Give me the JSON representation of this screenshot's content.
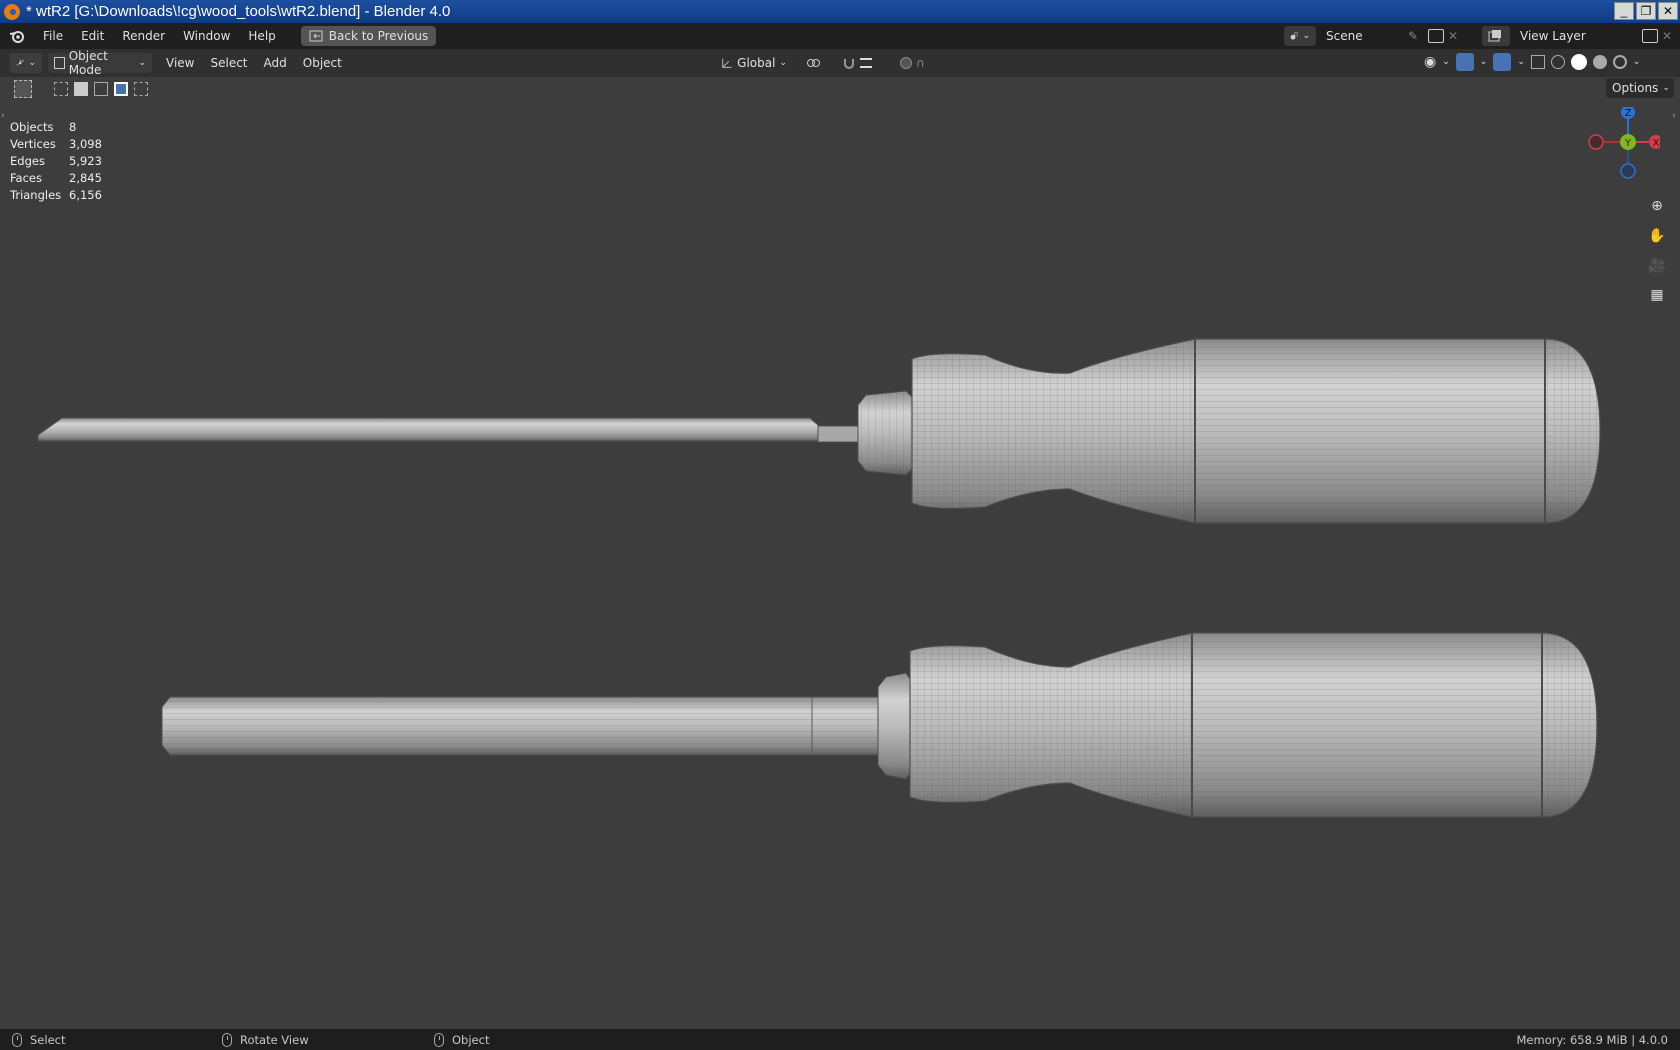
{
  "window": {
    "title": "* wtR2 [G:\\Downloads\\!cg\\wood_tools\\wtR2.blend] - Blender 4.0",
    "controls": [
      "_",
      "❐",
      "✕"
    ]
  },
  "menubar": {
    "items": [
      "File",
      "Edit",
      "Render",
      "Window",
      "Help"
    ],
    "back_button": "Back to Previous",
    "scene": "Scene",
    "view_layer": "View Layer"
  },
  "header": {
    "mode": "Object Mode",
    "menus": [
      "View",
      "Select",
      "Add",
      "Object"
    ],
    "orientation": "Global",
    "options": "Options"
  },
  "stats": [
    {
      "label": "Objects",
      "value": "8"
    },
    {
      "label": "Vertices",
      "value": "3,098"
    },
    {
      "label": "Edges",
      "value": "5,923"
    },
    {
      "label": "Faces",
      "value": "2,845"
    },
    {
      "label": "Triangles",
      "value": "6,156"
    }
  ],
  "gizmo": {
    "z": "Z",
    "y": "Y",
    "x": "X",
    "colors": {
      "z": "#2f6fd6",
      "y": "#84b51e",
      "x": "#d53c4c"
    }
  },
  "statusbar": {
    "left": "Select",
    "middle": "Rotate View",
    "right": "Object",
    "info": "Memory: 658.9 MiB | 4.0.0"
  },
  "colors": {
    "viewport": "#3d3d3d",
    "mesh": "#b8b8b8",
    "wire": "#4e4e4e",
    "titlebar": "#1d4fa0"
  }
}
